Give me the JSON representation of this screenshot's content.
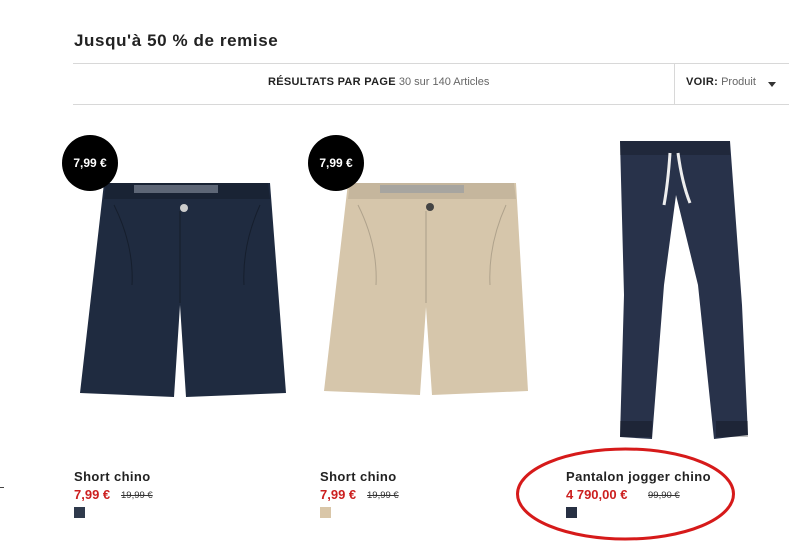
{
  "page": {
    "title": "Jusqu'à 50 % de remise"
  },
  "toolbar": {
    "results_label": "RÉSULTATS PAR PAGE",
    "results_value": "30 sur 140 Articles",
    "view_label": "VOIR:",
    "view_value": "Produit"
  },
  "products": [
    {
      "name": "Short chino",
      "badge": "7,99 €",
      "price": "7,99 €",
      "old_price": "19,99 €",
      "swatch_color": "#2f3a4c",
      "item_color": "#1f2b40"
    },
    {
      "name": "Short chino",
      "badge": "7,99 €",
      "price": "7,99 €",
      "old_price": "19,99 €",
      "swatch_color": "#d9c6a8",
      "item_color": "#d6c6ab"
    },
    {
      "name": "Pantalon jogger chino",
      "price": "4 790,00 €",
      "old_price": "99,90 €",
      "swatch_color": "#273043",
      "item_color": "#28324a"
    }
  ],
  "annotation": {
    "color": "#d61a1a"
  }
}
